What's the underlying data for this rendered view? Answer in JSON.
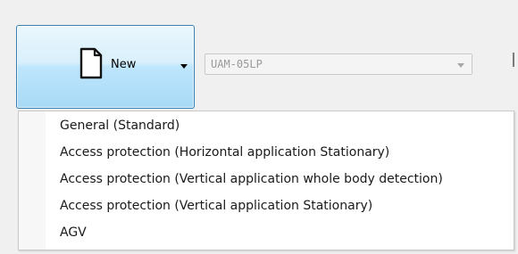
{
  "toolbar": {
    "new_label": "New",
    "new_icon": "document-icon",
    "new_split_icon": "chevron-down-icon"
  },
  "model_select": {
    "value": "UAM-05LP",
    "arrow_icon": "chevron-down-icon"
  },
  "new_menu": {
    "items": [
      {
        "label": "General (Standard)"
      },
      {
        "label": "Access protection (Horizontal application Stationary)"
      },
      {
        "label": "Access protection (Vertical application whole body detection)"
      },
      {
        "label": "Access protection (Vertical application Stationary)"
      },
      {
        "label": "AGV"
      }
    ]
  },
  "colors": {
    "button_border": "#3c7fb1",
    "button_fill_top": "#eaf6fd",
    "button_fill_bottom": "#a7d9f5",
    "menu_background": "#ffffff",
    "window_background": "#f0f0f0"
  }
}
